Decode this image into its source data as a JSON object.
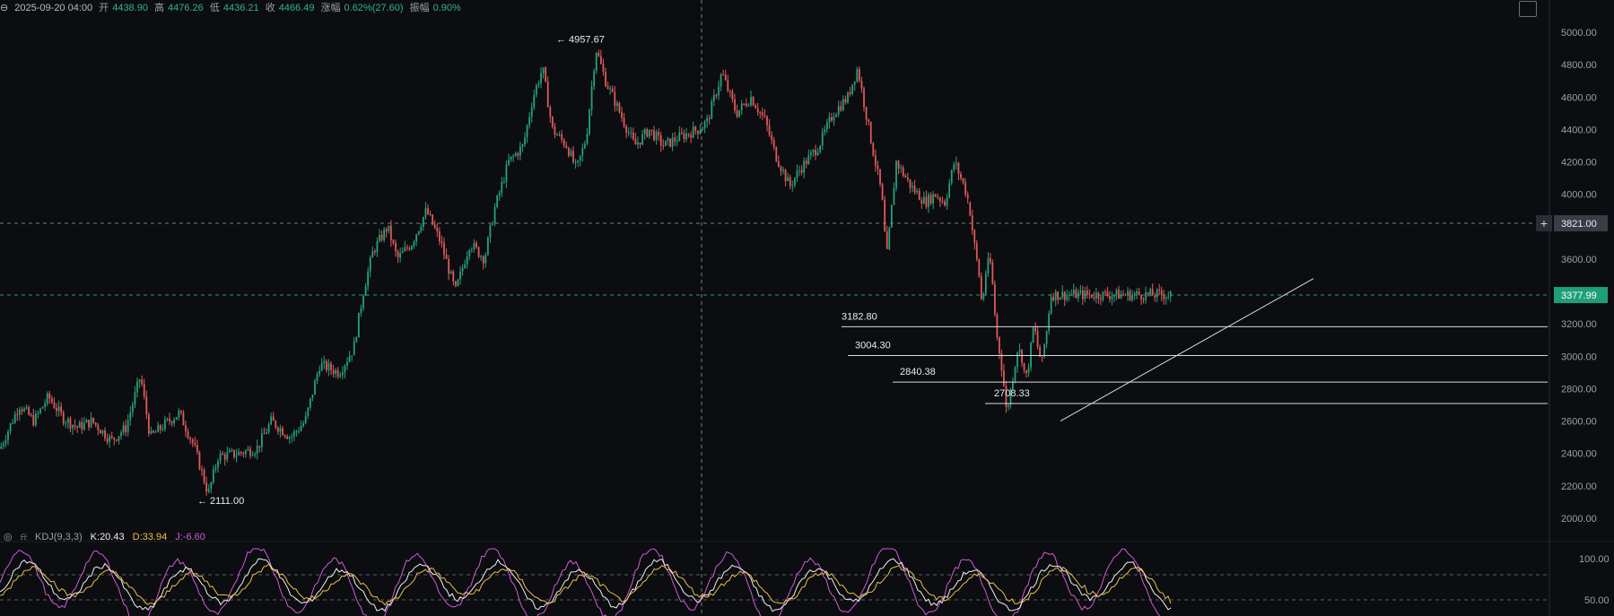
{
  "header": {
    "datetime": "2025-09-20 04:00",
    "open_label": "开",
    "open": "4438.90",
    "high_label": "高",
    "high": "4476.26",
    "low_label": "低",
    "low": "4436.21",
    "close_label": "收",
    "close": "4466.49",
    "change_label": "涨幅",
    "change": "0.62%(27.60)",
    "amp_label": "振幅",
    "amp": "0.90%"
  },
  "kdj": {
    "title": "KDJ(9,3,3)",
    "k": "K:20.43",
    "d": "D:33.94",
    "j": "J:-6.60"
  },
  "colors": {
    "up": "#26a17b",
    "down": "#e05a5a",
    "bg": "#0c0d10",
    "k": "#f0f0f0",
    "d": "#e8c04a",
    "j": "#d05ad8",
    "current": "#1f9f78"
  },
  "chart_data": {
    "type": "candlestick",
    "ylim": [
      1950,
      5100
    ],
    "y_ticks": [
      "5000.00",
      "4800.00",
      "4600.00",
      "4400.00",
      "4200.00",
      "4000.00",
      "3800.00",
      "3600.00",
      "3400.00",
      "3200.00",
      "3000.00",
      "2800.00",
      "2600.00",
      "2400.00",
      "2200.00",
      "2000.00"
    ],
    "price_path": [
      [
        0,
        2430
      ],
      [
        0.02,
        2700
      ],
      [
        0.035,
        2600
      ],
      [
        0.05,
        2750
      ],
      [
        0.065,
        2620
      ],
      [
        0.08,
        2560
      ],
      [
        0.095,
        2600
      ],
      [
        0.115,
        2480
      ],
      [
        0.13,
        2560
      ],
      [
        0.145,
        2880
      ],
      [
        0.155,
        2500
      ],
      [
        0.17,
        2580
      ],
      [
        0.185,
        2650
      ],
      [
        0.2,
        2450
      ],
      [
        0.215,
        2150
      ],
      [
        0.225,
        2380
      ],
      [
        0.245,
        2400
      ],
      [
        0.265,
        2430
      ],
      [
        0.28,
        2600
      ],
      [
        0.3,
        2500
      ],
      [
        0.315,
        2600
      ],
      [
        0.33,
        2950
      ],
      [
        0.35,
        2900
      ],
      [
        0.365,
        3050
      ],
      [
        0.375,
        3400
      ],
      [
        0.385,
        3650
      ],
      [
        0.4,
        3800
      ],
      [
        0.41,
        3600
      ],
      [
        0.425,
        3700
      ],
      [
        0.44,
        3900
      ],
      [
        0.455,
        3700
      ],
      [
        0.47,
        3400
      ],
      [
        0.485,
        3700
      ],
      [
        0.5,
        3600
      ],
      [
        0.51,
        3900
      ],
      [
        0.525,
        4200
      ],
      [
        0.54,
        4300
      ],
      [
        0.55,
        4600
      ],
      [
        0.56,
        4780
      ],
      [
        0.57,
        4400
      ],
      [
        0.585,
        4300
      ],
      [
        0.595,
        4150
      ],
      [
        0.605,
        4350
      ],
      [
        0.615,
        4900
      ],
      [
        0.625,
        4700
      ],
      [
        0.64,
        4500
      ],
      [
        0.655,
        4300
      ],
      [
        0.67,
        4400
      ],
      [
        0.685,
        4300
      ],
      [
        0.7,
        4350
      ],
      [
        0.72,
        4400
      ],
      [
        0.73,
        4450
      ],
      [
        0.745,
        4750
      ],
      [
        0.76,
        4500
      ],
      [
        0.775,
        4600
      ],
      [
        0.79,
        4450
      ],
      [
        0.8,
        4250
      ],
      [
        0.815,
        4050
      ],
      [
        0.825,
        4150
      ],
      [
        0.845,
        4300
      ],
      [
        0.86,
        4500
      ],
      [
        0.875,
        4600
      ],
      [
        0.885,
        4780
      ],
      [
        0.9,
        4300
      ],
      [
        0.91,
        4000
      ],
      [
        0.915,
        3600
      ],
      [
        0.925,
        4200
      ],
      [
        0.94,
        4050
      ],
      [
        0.955,
        3950
      ],
      [
        0.965,
        4000
      ],
      [
        0.975,
        3950
      ],
      [
        0.985,
        4200
      ],
      [
        0.995,
        4050
      ],
      [
        1.0,
        3950
      ]
    ],
    "price_path2": [
      [
        0,
        3950
      ],
      [
        0.025,
        3700
      ],
      [
        0.05,
        3500
      ],
      [
        0.065,
        3300
      ],
      [
        0.08,
        3500
      ],
      [
        0.1,
        3600
      ],
      [
        0.11,
        3550
      ],
      [
        0.125,
        3300
      ],
      [
        0.14,
        3100
      ],
      [
        0.155,
        3000
      ],
      [
        0.17,
        2850
      ],
      [
        0.185,
        2650
      ],
      [
        0.2,
        2750
      ],
      [
        0.22,
        2900
      ],
      [
        0.24,
        3050
      ],
      [
        0.26,
        3000
      ],
      [
        0.28,
        2850
      ],
      [
        0.3,
        3000
      ],
      [
        0.32,
        3200
      ],
      [
        0.34,
        3050
      ],
      [
        0.36,
        2950
      ],
      [
        0.375,
        3100
      ],
      [
        0.39,
        3200
      ],
      [
        0.4,
        3380
      ]
    ],
    "levels": [
      {
        "label": "3182.80",
        "value": 3182.8
      },
      {
        "label": "3004.30",
        "value": 3004.3
      },
      {
        "label": "2840.38",
        "value": 2840.38
      },
      {
        "label": "2708.33",
        "value": 2708.33
      }
    ],
    "high_marker": {
      "label": "← 4957.67",
      "value": 4957.67
    },
    "low_marker": {
      "label": "← 2111.00",
      "value": 2111.0
    },
    "crosshair_price": "3821.00",
    "current_price": "3377.99",
    "kdj_ticks": [
      "100.00",
      "50.00"
    ]
  }
}
